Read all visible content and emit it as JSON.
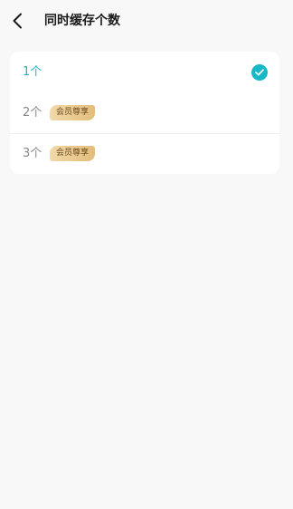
{
  "header": {
    "title": "同时缓存个数",
    "back_icon": "chevron-left-icon"
  },
  "options": [
    {
      "label": "1个",
      "selected": true,
      "badge": ""
    },
    {
      "label": "2个",
      "selected": false,
      "badge": "会员尊享"
    },
    {
      "label": "3个",
      "selected": false,
      "badge": "会员尊享"
    }
  ],
  "colors": {
    "accent": "#19b8c6",
    "badge_start": "#f1d9a9",
    "badge_end": "#e3bd7c",
    "badge_text": "#6b4a1d",
    "background": "#f8f8f8"
  },
  "icons": {
    "selected": "check-circle-icon"
  }
}
